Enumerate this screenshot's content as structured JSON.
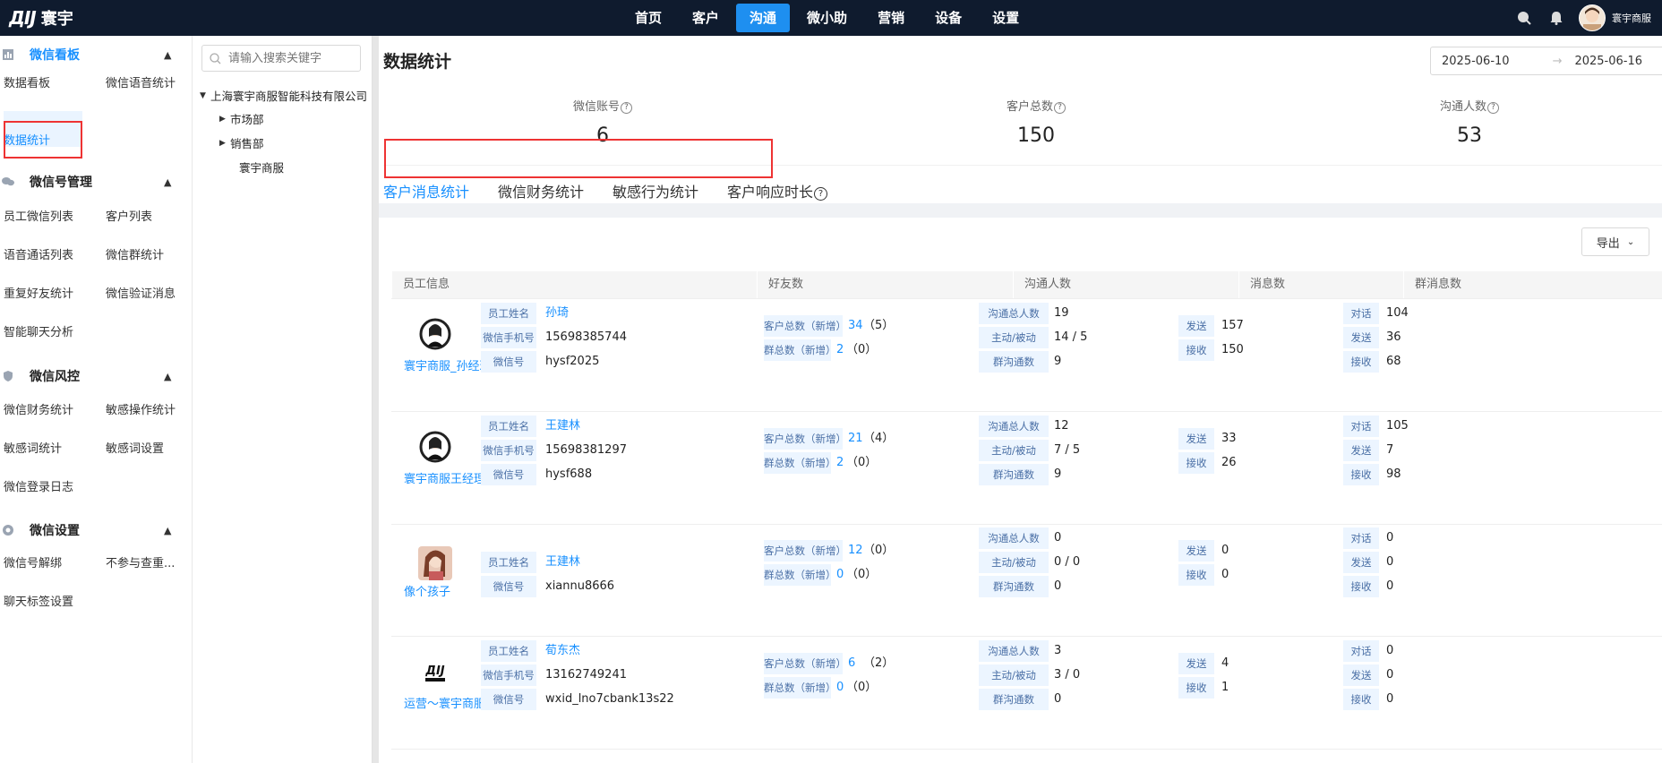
{
  "brand": {
    "logo_mark": "ДIJ",
    "name": "寰宇"
  },
  "nav": [
    {
      "label": "首页",
      "active": false
    },
    {
      "label": "客户",
      "active": false
    },
    {
      "label": "沟通",
      "active": true
    },
    {
      "label": "微小助",
      "active": false
    },
    {
      "label": "营销",
      "active": false
    },
    {
      "label": "设备",
      "active": false
    },
    {
      "label": "设置",
      "active": false
    }
  ],
  "user": {
    "name": "寰宇商服"
  },
  "sidebar": {
    "sections": [
      {
        "title": "微信看板",
        "icon": "chart-icon",
        "items": [
          "数据看板",
          "微信语音统计",
          "数据统计"
        ]
      },
      {
        "title": "微信号管理",
        "icon": "chat-bubbles-icon",
        "items": [
          "员工微信列表",
          "客户列表",
          "语音通话列表",
          "微信群统计",
          "重复好友统计",
          "微信验证消息",
          "智能聊天分析"
        ]
      },
      {
        "title": "微信风控",
        "icon": "shield-icon",
        "items": [
          "微信财务统计",
          "敏感操作统计",
          "敏感词统计",
          "敏感词设置",
          "微信登录日志"
        ]
      },
      {
        "title": "微信设置",
        "icon": "gear-icon",
        "items": [
          "微信号解绑",
          "不参与查重...",
          "聊天标签设置"
        ]
      }
    ],
    "active_item": "数据统计"
  },
  "tree": {
    "search_placeholder": "请输入搜索关键字",
    "root": "上海寰宇商服智能科技有限公司",
    "children": [
      "市场部",
      "销售部",
      "寰宇商服"
    ]
  },
  "main": {
    "title": "数据统计",
    "date_start": "2025-06-10",
    "date_sep": "→",
    "date_end": "2025-06-16",
    "stats": [
      {
        "label": "微信账号",
        "value": "6"
      },
      {
        "label": "客户总数",
        "value": "150"
      },
      {
        "label": "沟通人数",
        "value": "53"
      }
    ],
    "tabs": [
      "客户消息统计",
      "微信财务统计",
      "敏感行为统计",
      "客户响应时长"
    ],
    "active_tab": "客户消息统计",
    "export_label": "导出",
    "columns": [
      "员工信息",
      "好友数",
      "沟通人数",
      "消息数",
      "群消息数"
    ],
    "labels": {
      "emp_name": "员工姓名",
      "phone": "微信手机号",
      "wxid": "微信号",
      "cust_total": "客户总数（新增）",
      "group_total": "群总数（新增）",
      "comm_total": "沟通总人数",
      "active_passive": "主动/被动",
      "group_comm": "群沟通数",
      "send": "发送",
      "recv": "接收",
      "dialog": "对话"
    },
    "rows": [
      {
        "display": "寰宇商服_孙经理",
        "name": "孙琦",
        "phone": "15698385744",
        "wxid": "hysf2025",
        "cust": "34",
        "cust_new": "（5）",
        "group": "2",
        "group_new": "（0）",
        "comm_total": "19",
        "ap": "14 / 5",
        "group_comm": "9",
        "send": "157",
        "recv": "150",
        "g_dialog": "104",
        "g_send": "36",
        "g_recv": "68"
      },
      {
        "display": "寰宇商服王经理",
        "name": "王建林",
        "phone": "15698381297",
        "wxid": "hysf688",
        "cust": "21",
        "cust_new": "（4）",
        "group": "2",
        "group_new": "（0）",
        "comm_total": "12",
        "ap": "7 / 5",
        "group_comm": "9",
        "send": "33",
        "recv": "26",
        "g_dialog": "105",
        "g_send": "7",
        "g_recv": "98"
      },
      {
        "display": "像个孩子",
        "name": "王建林",
        "phone": "",
        "wxid": "xiannu8666",
        "cust": "12",
        "cust_new": "（0）",
        "group": "0",
        "group_new": "（0）",
        "comm_total": "0",
        "ap": "0 / 0",
        "group_comm": "0",
        "send": "0",
        "recv": "0",
        "g_dialog": "0",
        "g_send": "0",
        "g_recv": "0"
      },
      {
        "display": "运营～寰宇商服",
        "name": "荀东杰",
        "phone": "13162749241",
        "wxid": "wxid_lno7cbank13s22",
        "cust": "6",
        "cust_new": "（2）",
        "group": "0",
        "group_new": "（0）",
        "comm_total": "3",
        "ap": "3 / 0",
        "group_comm": "0",
        "send": "4",
        "recv": "1",
        "g_dialog": "0",
        "g_send": "0",
        "g_recv": "0"
      }
    ]
  }
}
